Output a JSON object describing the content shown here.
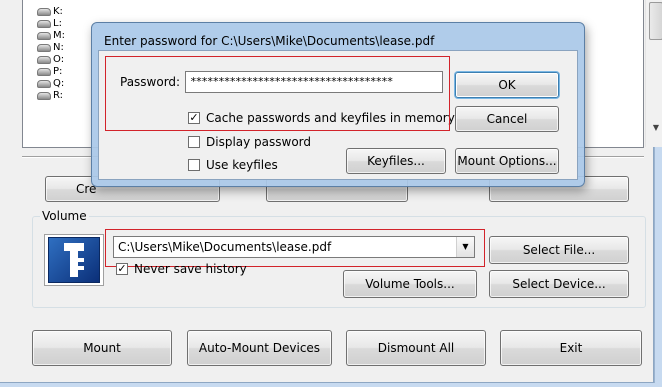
{
  "drives": [
    "K:",
    "L:",
    "M:",
    "N:",
    "O:",
    "P:",
    "Q:",
    "R:"
  ],
  "main": {
    "create_volume_partial": "Cre",
    "volume_group_label": "Volume",
    "volume_path": "C:\\Users\\Mike\\Documents\\lease.pdf",
    "never_save_history_label": "Never save history",
    "never_save_history_checked": "✓",
    "select_file_label": "Select File...",
    "volume_tools_label": "Volume Tools...",
    "select_device_label": "Select Device...",
    "mount_label": "Mount",
    "auto_mount_label": "Auto-Mount Devices",
    "dismount_all_label": "Dismount All",
    "exit_label": "Exit"
  },
  "dialog": {
    "title": "Enter password for C:\\Users\\Mike\\Documents\\lease.pdf",
    "password_label": "Password:",
    "password_value": "************************************",
    "ok_label": "OK",
    "cancel_label": "Cancel",
    "cache_label": "Cache passwords and keyfiles in memory",
    "cache_checked": "✓",
    "display_password_label": "Display password",
    "use_keyfiles_label": "Use keyfiles",
    "keyfiles_label": "Keyfiles...",
    "mount_options_label": "Mount Options..."
  },
  "colors": {
    "highlight_box": "#d2232a",
    "window_bg": "#f0f0f0",
    "frame_glass": "#b9d1ea"
  },
  "icons": {
    "drive": "drive-icon",
    "logo": "truecrypt-key-logo-icon",
    "dropdown": "chevron-down-icon"
  }
}
